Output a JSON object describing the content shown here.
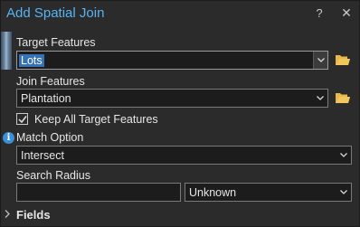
{
  "dialog": {
    "title": "Add Spatial Join",
    "help_glyph": "?",
    "close_glyph": "✕"
  },
  "params": {
    "target_features": {
      "label": "Target Features",
      "value": "Lots"
    },
    "join_features": {
      "label": "Join Features",
      "value": "Plantation"
    },
    "keep_all": {
      "label": "Keep All Target Features",
      "checked": true
    },
    "match_option": {
      "label": "Match Option",
      "value": "Intersect"
    },
    "search_radius": {
      "label": "Search Radius",
      "value": "",
      "unit": "Unknown"
    },
    "fields": {
      "label": "Fields",
      "expanded": false
    }
  },
  "icons": {
    "help": "question-mark-icon",
    "close": "close-icon",
    "browse": "folder-icon",
    "info": "info-icon",
    "dropdown": "chevron-down-icon",
    "expander": "chevron-right-icon"
  },
  "colors": {
    "background": "#2b2b2b",
    "title": "#56b4f5",
    "selection": "#3672b5",
    "folder": "#e8b84a",
    "info": "#3b8fd6"
  }
}
